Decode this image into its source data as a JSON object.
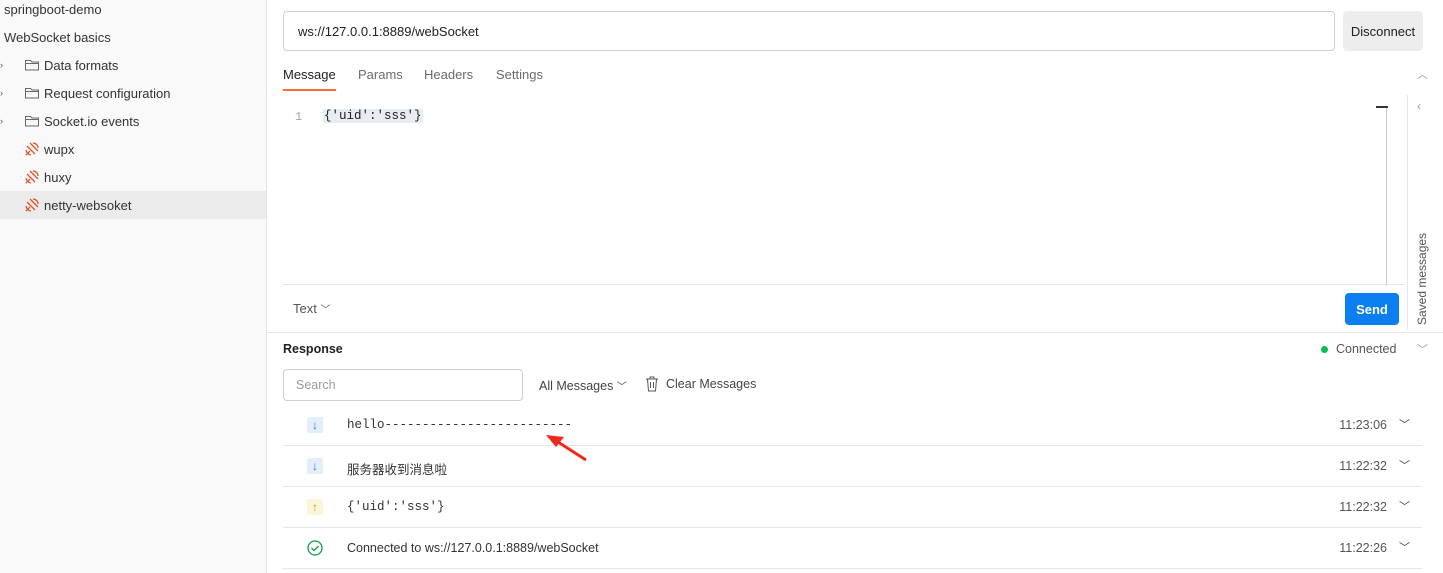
{
  "sidebar": {
    "items": [
      {
        "label": "springboot-demo"
      },
      {
        "label": "WebSocket basics"
      },
      {
        "label": "Data formats",
        "type": "folder"
      },
      {
        "label": "Request configuration",
        "type": "folder"
      },
      {
        "label": "Socket.io events",
        "type": "folder"
      },
      {
        "label": "wupx",
        "type": "websocket"
      },
      {
        "label": "huxy",
        "type": "websocket"
      },
      {
        "label": "netty-websoket",
        "type": "websocket",
        "active": true
      }
    ]
  },
  "request": {
    "url": "ws://127.0.0.1:8889/webSocket",
    "disconnect": "Disconnect"
  },
  "tabs": [
    "Message",
    "Params",
    "Headers",
    "Settings"
  ],
  "editor": {
    "line": "1",
    "code": "{'uid':'sss'}"
  },
  "format": "Text",
  "send": "Send",
  "saved_messages": "Saved messages",
  "response": {
    "title": "Response",
    "status": "Connected",
    "search_placeholder": "Search",
    "filter": "All Messages",
    "clear": "Clear Messages",
    "messages": [
      {
        "dir": "in",
        "text": "hello-------------------------",
        "time": "11:23:06",
        "mono": true
      },
      {
        "dir": "in",
        "text": "服务器收到消息啦",
        "time": "11:22:32"
      },
      {
        "dir": "out",
        "text": "{'uid':'sss'}",
        "time": "11:22:32",
        "mono": true
      },
      {
        "dir": "connected",
        "text": "Connected to ws://127.0.0.1:8889/webSocket",
        "time": "11:22:26"
      }
    ]
  },
  "colors": {
    "accent": "#ff6c37",
    "send": "#0b7ff0",
    "connected": "#0cbb52"
  }
}
